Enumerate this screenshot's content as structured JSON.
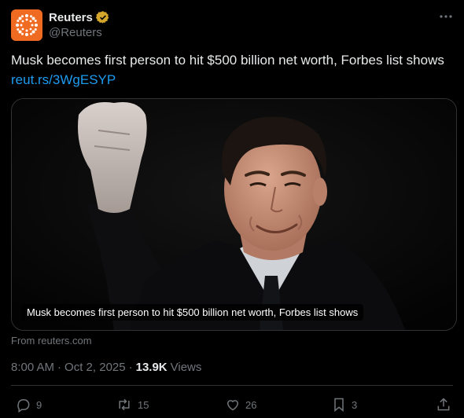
{
  "author": {
    "display_name": "Reuters",
    "handle": "@Reuters",
    "avatar_icon": "reuters-logo",
    "verified_icon": "verified-badge-icon",
    "verified_color": "#d4a72c",
    "avatar_color": "#f06b22"
  },
  "tweet": {
    "text": "Musk becomes first person to hit $500 billion net worth, Forbes list shows ",
    "link": "reut.rs/3WgESYP"
  },
  "media": {
    "caption": "Musk becomes first person to hit $500 billion net worth, Forbes list shows"
  },
  "source": "From reuters.com",
  "meta": {
    "time": "8:00 AM",
    "separator": "·",
    "date": "Oct 2, 2025",
    "separator2": "·",
    "views_count": "13.9K",
    "views_label": "Views"
  },
  "actions": {
    "replies": "9",
    "reposts": "15",
    "likes": "26",
    "bookmarks": "3"
  },
  "colors": {
    "background": "#000000",
    "text": "#e7e9ea",
    "muted": "#71767b",
    "link": "#1d9bf0"
  }
}
